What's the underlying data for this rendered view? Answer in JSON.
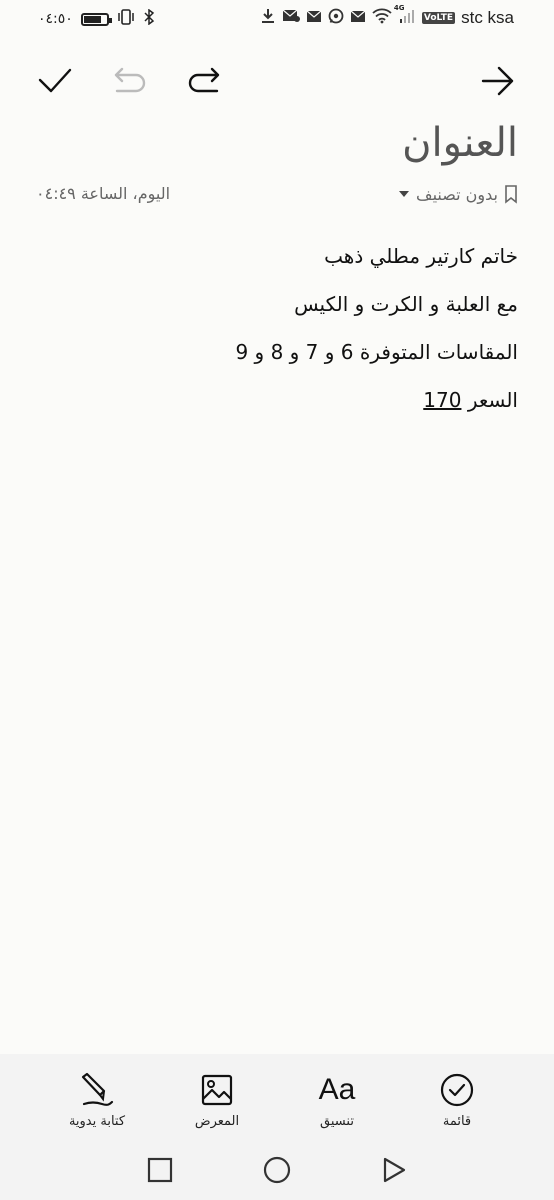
{
  "status": {
    "time": "٠٤:٥٠",
    "carrier": "stc ksa",
    "network_type": "4G",
    "volte": "VoLTE",
    "battery_level": 0.8
  },
  "toolbar": {
    "back_icon": "arrow-icon",
    "redo_icon": "redo-icon",
    "undo_icon": "undo-icon",
    "save_icon": "check-icon"
  },
  "note": {
    "title": "العنوان",
    "category": "بدون تصنيف",
    "datetime": "اليوم، الساعة ٠٤:٤٩",
    "lines": [
      "خاتم كارتير مطلي ذهب",
      "مع العلبة و الكرت و الكيس",
      "المقاسات المتوفرة 6 و 7 و 8 و 9"
    ],
    "price_label": "السعر",
    "price_value": "170"
  },
  "bottom_tools": {
    "list": "قائمة",
    "format": "تنسيق",
    "format_glyph": "Aa",
    "gallery": "المعرض",
    "handwriting": "كتابة يدوية"
  }
}
